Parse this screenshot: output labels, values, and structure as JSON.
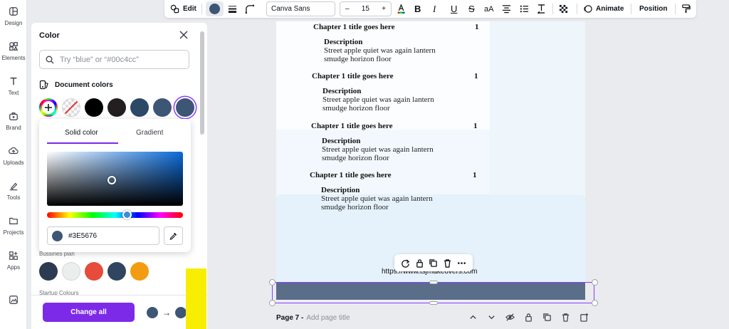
{
  "rail": {
    "items": [
      {
        "label": "Design",
        "icon": "design-icon"
      },
      {
        "label": "Elements",
        "icon": "elements-icon"
      },
      {
        "label": "Text",
        "icon": "text-icon"
      },
      {
        "label": "Brand",
        "icon": "brand-icon"
      },
      {
        "label": "Uploads",
        "icon": "uploads-icon"
      },
      {
        "label": "Tools",
        "icon": "tools-icon"
      },
      {
        "label": "Projects",
        "icon": "projects-icon"
      },
      {
        "label": "Apps",
        "icon": "apps-icon"
      },
      {
        "label": "",
        "icon": "magic-media-icon"
      }
    ]
  },
  "panel": {
    "title": "Color",
    "search_placeholder": "Try “blue” or “#00c4cc”",
    "document_colors_label": "Document colors",
    "document_colors": [
      "#000000",
      "#231f20",
      "#2c4a66",
      "#3e5676",
      "#3e5676"
    ],
    "section2_label": "Bussines plan",
    "section2_colors": [
      "#2b3b52",
      "#eceded",
      "#e64b3b",
      "#2f4560",
      "#f39c12"
    ],
    "section3_label": "Startup Colours",
    "change_all_label": "Change all",
    "compare_arrow": "→"
  },
  "picker": {
    "tab_solid": "Solid color",
    "tab_gradient": "Gradient",
    "hex_value": "#3E5676"
  },
  "toolbar": {
    "edit_label": "Edit",
    "font_name": "Canva Sans",
    "font_size_minus": "–",
    "font_size": "15",
    "font_size_plus": "+",
    "case_label": "aA",
    "animate_label": "Animate",
    "position_label": "Position",
    "selected_color": "#3E5676"
  },
  "canvas": {
    "toc": [
      {
        "title": "Chapter 1 title goes here",
        "page": "1",
        "desc_head": "Description",
        "desc_line1": "Street apple quiet was again lantern",
        "desc_line2": "smudge horizon floor"
      },
      {
        "title": "Chapter 1 title goes here",
        "page": "1",
        "desc_head": "Description",
        "desc_line1": "Street apple quiet was again lantern",
        "desc_line2": "smudge horizon floor"
      },
      {
        "title": "Chapter 1 title goes here",
        "page": "1",
        "desc_head": "Description",
        "desc_line1": "Street apple quiet was again lantern",
        "desc_line2": "smudge horizon floor"
      },
      {
        "title": "Chapter 1 title goes here",
        "page": "1",
        "desc_head": "Description",
        "desc_line1": "Street apple quiet was again lantern",
        "desc_line2": "smudge horizon floor"
      }
    ],
    "url": "https://www.tsjmakeovers.com",
    "selected_shape_color": "#5a6e8a"
  },
  "page_footer": {
    "page_label": "Page 7 -",
    "add_title": "Add page title"
  }
}
